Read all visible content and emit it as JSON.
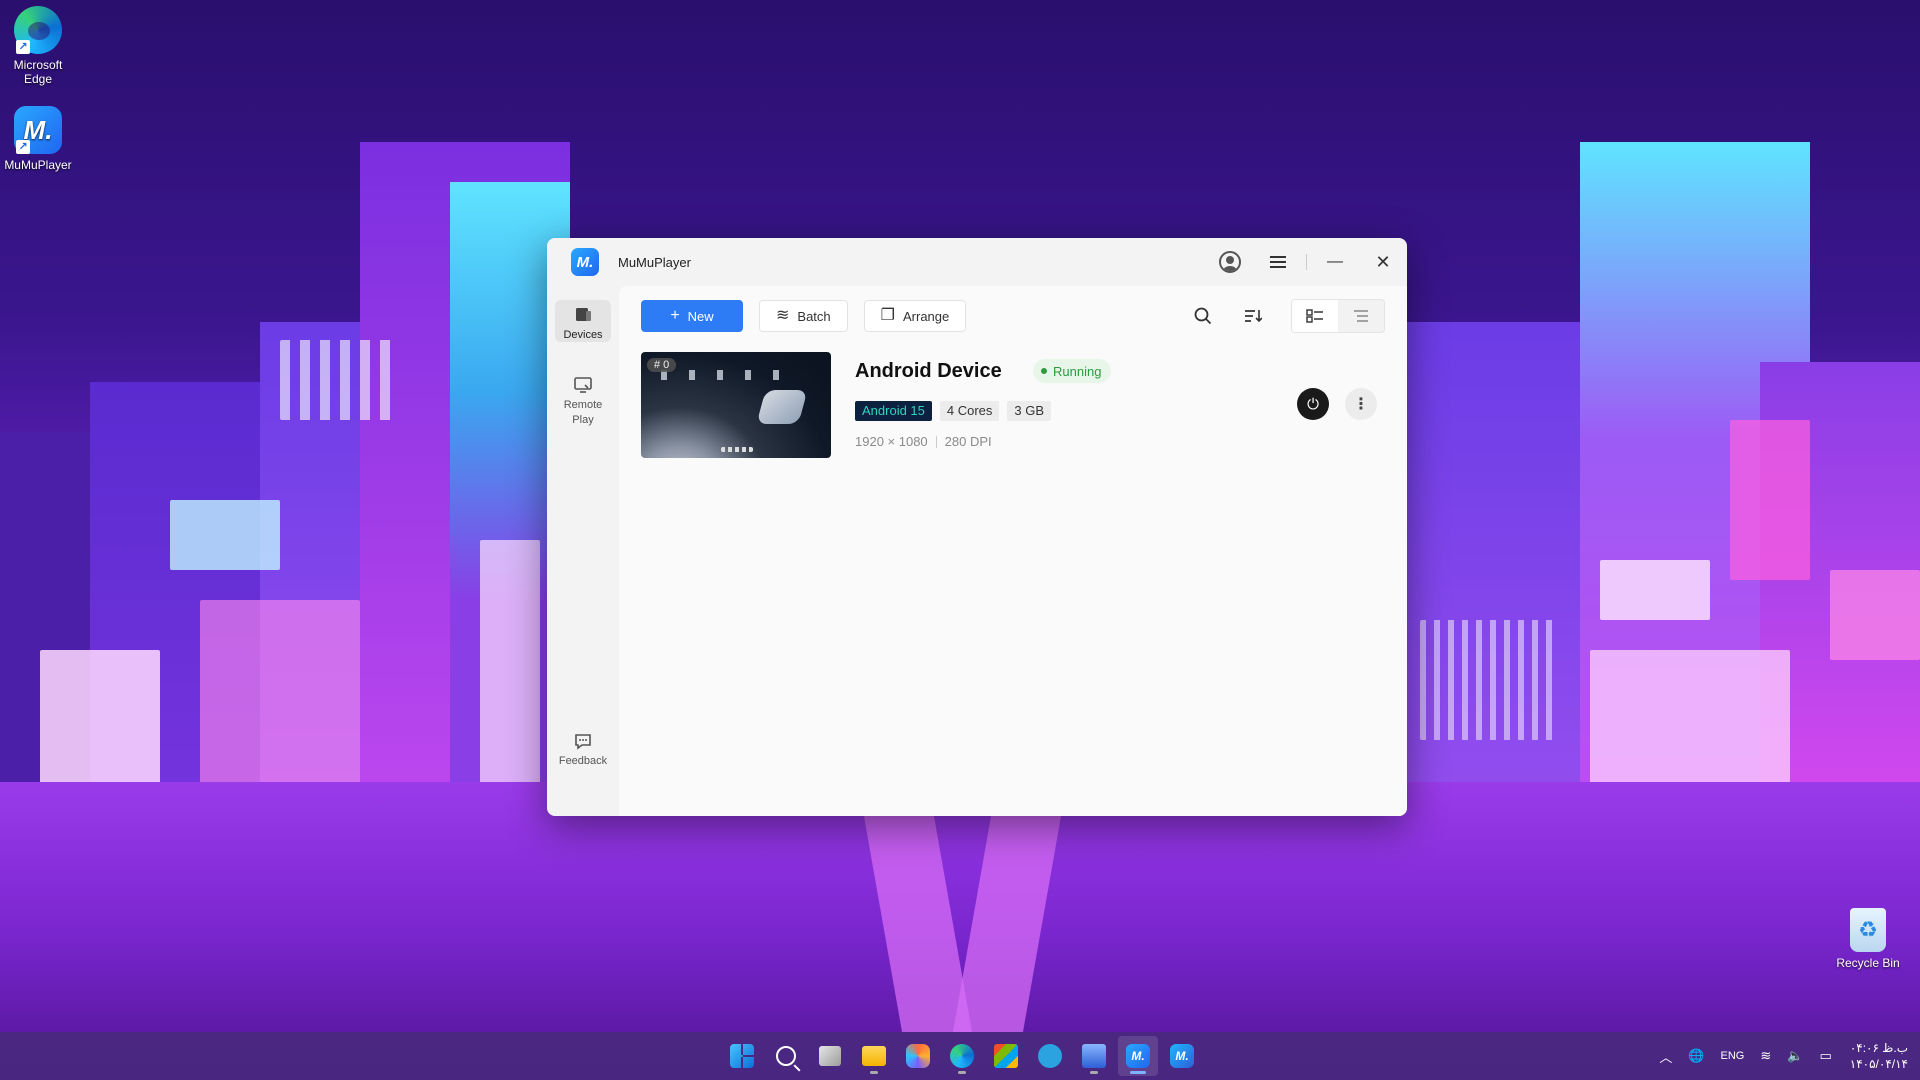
{
  "desktop": {
    "icons": [
      {
        "label": "Microsoft\nEdge"
      },
      {
        "label": "MuMuPlayer"
      }
    ],
    "recycle_bin_label": "Recycle Bin"
  },
  "window": {
    "title": "MuMuPlayer",
    "logo_text": "M."
  },
  "sidebar": {
    "items": [
      {
        "label": "Devices",
        "icon": "devices-icon"
      },
      {
        "label": "Remote Play",
        "icon": "remote-play-icon"
      },
      {
        "label": "Feedback",
        "icon": "feedback-icon"
      }
    ]
  },
  "toolbar": {
    "new_label": "New",
    "batch_label": "Batch",
    "arrange_label": "Arrange"
  },
  "device": {
    "index": "# 0",
    "name": "Android Device",
    "status": "Running",
    "android_version": "Android 15",
    "cores": "4 Cores",
    "memory": "3 GB",
    "resolution": "1920 × 1080",
    "dpi": "280 DPI"
  },
  "taskbar": {
    "language": "ENG",
    "clock_time": "ب.ظ ۰۴:۰۶",
    "clock_date": "۱۴۰۵/۰۴/۱۴"
  },
  "colors": {
    "accent": "#2d7cf6",
    "running": "#2e9a3e",
    "android_tag_bg": "#0c2140",
    "android_tag_fg": "#2fd3c0"
  }
}
